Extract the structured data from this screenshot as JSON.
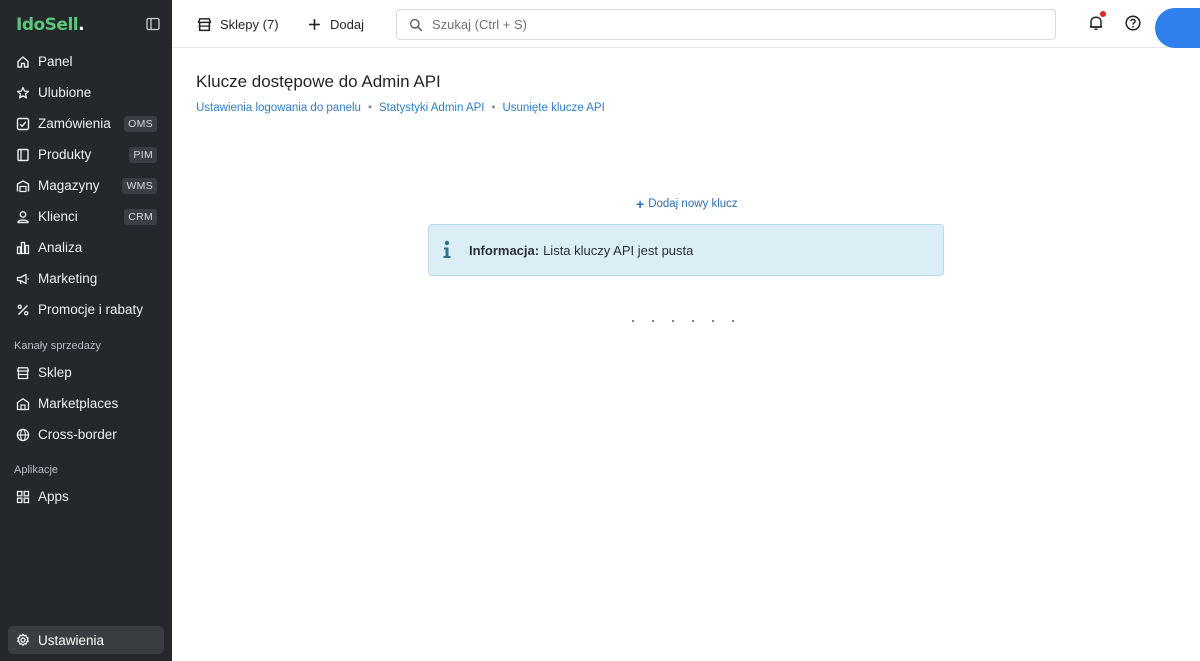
{
  "sidebar": {
    "logo_main": "IdoSell",
    "logo_dot": ".",
    "items": [
      {
        "label": "Panel",
        "badge": ""
      },
      {
        "label": "Ulubione",
        "badge": ""
      },
      {
        "label": "Zamówienia",
        "badge": "OMS"
      },
      {
        "label": "Produkty",
        "badge": "PIM"
      },
      {
        "label": "Magazyny",
        "badge": "WMS"
      },
      {
        "label": "Klienci",
        "badge": "CRM"
      },
      {
        "label": "Analiza",
        "badge": ""
      },
      {
        "label": "Marketing",
        "badge": ""
      },
      {
        "label": "Promocje i rabaty",
        "badge": ""
      }
    ],
    "section_sales": "Kanały sprzedaży",
    "sales_items": [
      {
        "label": "Sklep"
      },
      {
        "label": "Marketplaces"
      },
      {
        "label": "Cross-border"
      }
    ],
    "section_apps": "Aplikacje",
    "apps_items": [
      {
        "label": "Apps"
      }
    ],
    "settings_label": "Ustawienia"
  },
  "topbar": {
    "stores_label": "Sklepy (7)",
    "add_label": "Dodaj",
    "search_placeholder": "Szukaj (Ctrl + S)"
  },
  "main": {
    "title": "Klucze dostępowe do Admin API",
    "breadcrumb": [
      "Ustawienia logowania do panelu",
      "Statystyki Admin API",
      "Usunięte klucze API"
    ],
    "breadcrumb_sep": "•",
    "add_key_label": "Dodaj nowy klucz",
    "info_strong": "Informacja:",
    "info_message": "Lista kluczy API jest pusta"
  },
  "colors": {
    "sidebar_bg": "#24272b",
    "accent_link": "#2f7fc6",
    "logo_green": "#5cc77a",
    "info_bg": "#dbeef6",
    "avatar": "#2f80ed",
    "notification_dot": "#e02424"
  }
}
